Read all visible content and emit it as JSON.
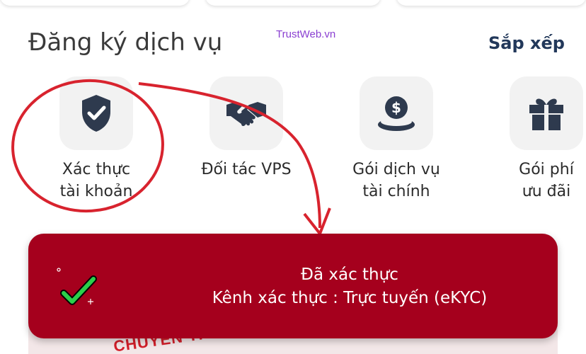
{
  "section": {
    "title": "Đăng ký dịch vụ",
    "watermark": "TrustWeb.vn",
    "sort_label": "Sắp xếp"
  },
  "services": [
    {
      "icon": "shield-check-icon",
      "label_line1": "Xác thực",
      "label_line2": "tài khoản"
    },
    {
      "icon": "handshake-icon",
      "label_line1": "Đối tác VPS",
      "label_line2": ""
    },
    {
      "icon": "money-coin-icon",
      "label_line1": "Gói dịch vụ",
      "label_line2": "tài chính"
    },
    {
      "icon": "gift-icon",
      "label_line1": "Gói phí",
      "label_line2": "ưu đãi"
    }
  ],
  "toast": {
    "title": "Đã xác thực",
    "subtitle": "Kênh xác thực : Trực tuyến (eKYC)",
    "icon": "green-check-icon"
  },
  "banner": {
    "peek_text": "CHUYỂN TI"
  },
  "colors": {
    "toast_bg": "#a5001d",
    "icon_fill": "#2e3a4e",
    "annotation_red": "#d8232e",
    "link": "#22385a"
  }
}
